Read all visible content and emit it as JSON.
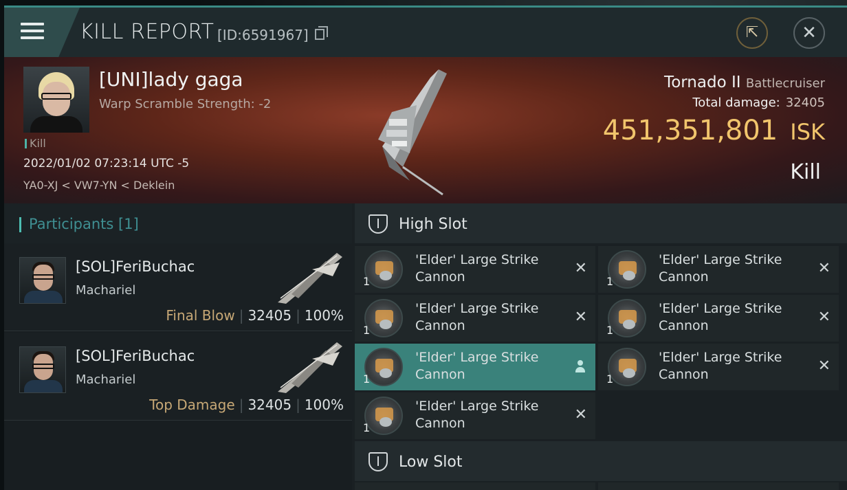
{
  "header": {
    "title": "KILL REPORT",
    "report_id": "[ID:6591967]"
  },
  "victim": {
    "name": "[UNI]lady gaga",
    "warp_scramble": "Warp Scramble Strength: -2",
    "tag": "Kill",
    "datetime": "2022/01/02 07:23:14 UTC -5",
    "location": "YA0-XJ < VW7-YN < Deklein",
    "ship": "Tornado II",
    "ship_class": "Battlecruiser",
    "total_damage_label": "Total damage:",
    "total_damage": "32405",
    "isk_value": "451,351,801",
    "isk_label": "ISK",
    "result": "Kill"
  },
  "participants": {
    "label": "Participants",
    "count": "[1]",
    "rows": [
      {
        "name": "[SOL]FeriBuchac",
        "ship": "Machariel",
        "role": "Final Blow",
        "damage": "32405",
        "percent": "100%"
      },
      {
        "name": "[SOL]FeriBuchac",
        "ship": "Machariel",
        "role": "Top Damage",
        "damage": "32405",
        "percent": "100%"
      }
    ]
  },
  "slots": {
    "high_label": "High Slot",
    "low_label": "Low Slot",
    "high_items": [
      {
        "name": "'Elder' Large Strike Cannon",
        "qty": "1"
      },
      {
        "name": "'Elder' Large Strike Cannon",
        "qty": "1"
      },
      {
        "name": "'Elder' Large Strike Cannon",
        "qty": "1"
      },
      {
        "name": "'Elder' Large Strike Cannon",
        "qty": "1"
      },
      {
        "name": "'Elder' Large Strike Cannon",
        "qty": "1"
      },
      {
        "name": "'Elder' Large Strike Cannon",
        "qty": "1"
      },
      {
        "name": "'Elder' Large Strike Cannon",
        "qty": "1"
      }
    ]
  },
  "colors": {
    "accent": "#3a827b",
    "isk": "#f1c56c",
    "role": "#c7a876"
  }
}
